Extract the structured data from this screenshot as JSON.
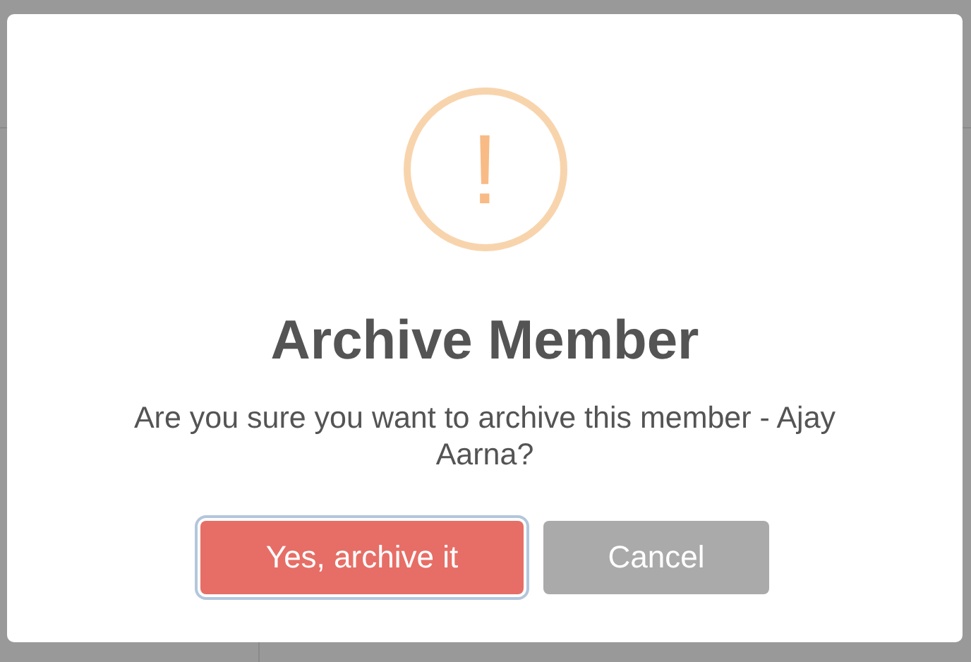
{
  "dialog": {
    "icon": {
      "glyph": "!"
    },
    "title": "Archive Member",
    "message": "Are you sure you want to archive this member - Ajay Aarna?",
    "buttons": [
      {
        "label": "Yes, archive it",
        "kind": "confirm",
        "focused": true
      },
      {
        "label": "Cancel",
        "kind": "cancel",
        "focused": false
      }
    ]
  }
}
